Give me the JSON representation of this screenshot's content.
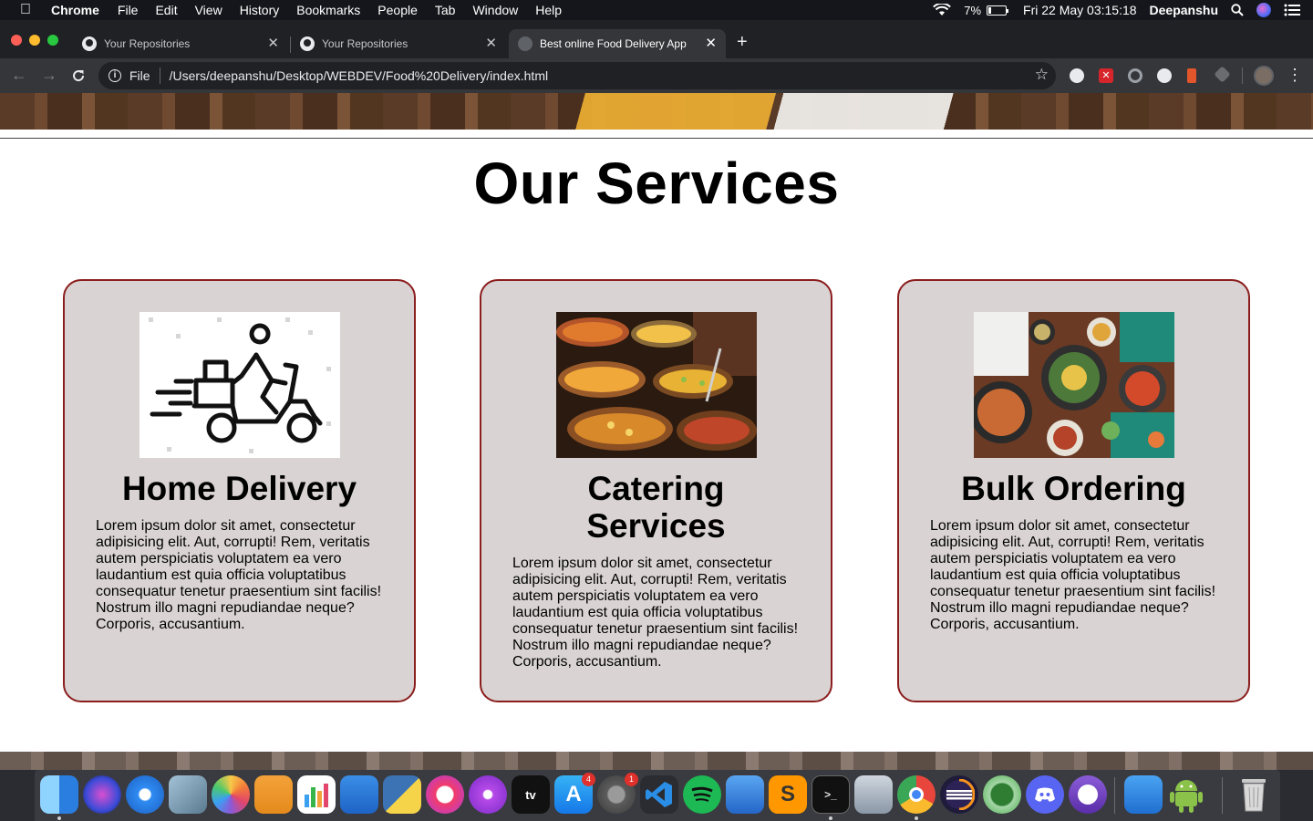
{
  "menubar": {
    "app_name": "Chrome",
    "items": [
      "File",
      "Edit",
      "View",
      "History",
      "Bookmarks",
      "People",
      "Tab",
      "Window",
      "Help"
    ],
    "battery": "7%",
    "clock": "Fri 22 May  03:15:18",
    "user": "Deepanshu"
  },
  "tabs": [
    {
      "title": "Your Repositories",
      "icon": "github-icon"
    },
    {
      "title": "Your Repositories",
      "icon": "github-icon"
    },
    {
      "title": "Best online Food Delivery App",
      "icon": "globe-icon",
      "active": true
    }
  ],
  "toolbar": {
    "scheme_label": "File",
    "url": "/Users/deepanshu/Desktop/WEBDEV/Food%20Delivery/index.html"
  },
  "page": {
    "section_title": "Our Services",
    "cards": [
      {
        "title": "Home Delivery",
        "image": "scooter-delivery-icon",
        "text": "Lorem ipsum dolor sit amet, consectetur adipisicing elit. Aut, corrupti! Rem, veritatis autem perspiciatis voluptatem ea vero laudantium est quia officia voluptatibus consequatur tenetur praesentium sint facilis! Nostrum illo magni repudiandae neque? Corporis, accusantium."
      },
      {
        "title": "Catering Services",
        "image": "buffet-food-photo",
        "text": "Lorem ipsum dolor sit amet, consectetur adipisicing elit. Aut, corrupti! Rem, veritatis autem perspiciatis voluptatem ea vero laudantium est quia officia voluptatibus consequatur tenetur praesentium sint facilis! Nostrum illo magni repudiandae neque? Corporis, accusantium."
      },
      {
        "title": "Bulk Ordering",
        "image": "food-spread-photo",
        "text": "Lorem ipsum dolor sit amet, consectetur adipisicing elit. Aut, corrupti! Rem, veritatis autem perspiciatis voluptatem ea vero laudantium est quia officia voluptatibus consequatur tenetur praesentium sint facilis! Nostrum illo magni repudiandae neque? Corporis, accusantium."
      }
    ]
  },
  "dock": {
    "badges": {
      "app_store": "4",
      "system_preferences": "1"
    },
    "apple_tv_label": "tv"
  },
  "colors": {
    "card_border": "#8b1d1d",
    "card_background": "#d9d4d3",
    "menubar_background": "#15161b",
    "chrome_frame": "#202124",
    "chrome_toolbar": "#35363a"
  }
}
